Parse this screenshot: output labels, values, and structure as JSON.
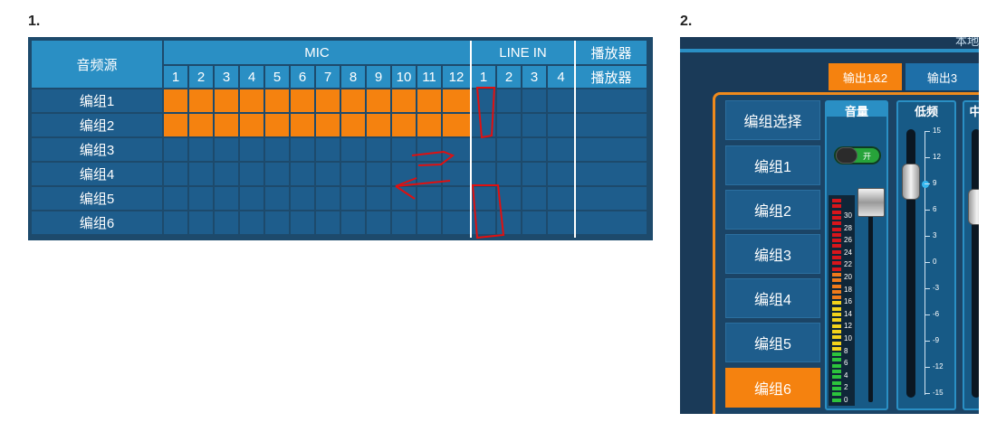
{
  "panel1": {
    "number": "1.",
    "source_header": "音频源",
    "groups_top": [
      {
        "label": "MIC",
        "span": 12
      },
      {
        "label": "LINE IN",
        "span": 4
      },
      {
        "label": "播放器",
        "span": 1
      }
    ],
    "sub_headers": [
      "1",
      "2",
      "3",
      "4",
      "5",
      "6",
      "7",
      "8",
      "9",
      "10",
      "11",
      "12",
      "1",
      "2",
      "3",
      "4",
      "播放器"
    ],
    "rows": [
      {
        "label": "编组1",
        "active": [
          1,
          1,
          1,
          1,
          1,
          1,
          1,
          1,
          1,
          1,
          1,
          1,
          0,
          0,
          0,
          0,
          0
        ]
      },
      {
        "label": "编组2",
        "active": [
          1,
          1,
          1,
          1,
          1,
          1,
          1,
          1,
          1,
          1,
          1,
          1,
          0,
          0,
          0,
          0,
          0
        ]
      },
      {
        "label": "编组3",
        "active": [
          0,
          0,
          0,
          0,
          0,
          0,
          0,
          0,
          0,
          0,
          0,
          0,
          0,
          0,
          0,
          0,
          0
        ]
      },
      {
        "label": "编组4",
        "active": [
          0,
          0,
          0,
          0,
          0,
          0,
          0,
          0,
          0,
          0,
          0,
          0,
          0,
          0,
          0,
          0,
          0
        ]
      },
      {
        "label": "编组5",
        "active": [
          0,
          0,
          0,
          0,
          0,
          0,
          0,
          0,
          0,
          0,
          0,
          0,
          0,
          0,
          0,
          0,
          0
        ]
      },
      {
        "label": "编组6",
        "active": [
          0,
          0,
          0,
          0,
          0,
          0,
          0,
          0,
          0,
          0,
          0,
          0,
          0,
          0,
          0,
          0,
          0
        ]
      }
    ],
    "colors": {
      "header": "#2a8fc4",
      "cell": "#1e5d8c",
      "active": "#f5820f",
      "annotation": "#e01010"
    }
  },
  "panel2": {
    "number": "2.",
    "top_fragment": "本地",
    "output_tabs": [
      {
        "label": "输出1&2",
        "selected": true
      },
      {
        "label": "输出3",
        "selected": false
      }
    ],
    "group_buttons": [
      {
        "label": "编组选择",
        "selected": false
      },
      {
        "label": "编组1",
        "selected": false
      },
      {
        "label": "编组2",
        "selected": false
      },
      {
        "label": "编组3",
        "selected": false
      },
      {
        "label": "编组4",
        "selected": false
      },
      {
        "label": "编组5",
        "selected": false
      },
      {
        "label": "编组6",
        "selected": true
      }
    ],
    "volume": {
      "label": "音量",
      "switch_label": "开",
      "meter_ticks": [
        "30",
        "28",
        "26",
        "24",
        "22",
        "20",
        "18",
        "16",
        "14",
        "12",
        "10",
        "8",
        "6",
        "4",
        "2",
        "0"
      ]
    },
    "bass": {
      "label": "低频",
      "ticks": [
        "15",
        "12",
        "9",
        "6",
        "3",
        "0",
        "-3",
        "-6",
        "-9",
        "-12",
        "-15"
      ]
    },
    "mid_label_fragment": "中",
    "colors": {
      "accent": "#f5820f",
      "panel_bg": "#1a3a58",
      "strip_bg": "#175a86"
    }
  }
}
